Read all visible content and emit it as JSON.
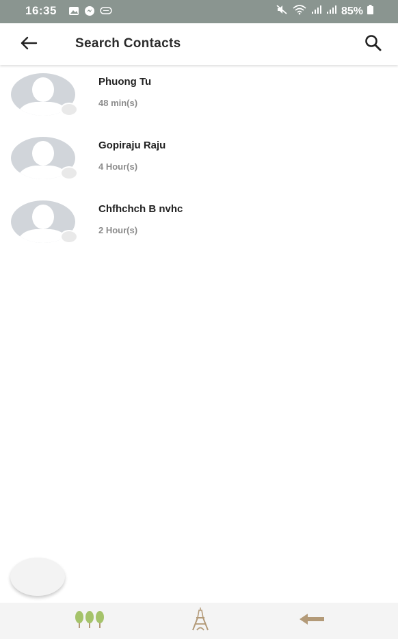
{
  "status_bar": {
    "time": "16:35",
    "battery_percent": "85%",
    "icons_left": [
      "image-icon",
      "messenger-icon",
      "chat-bubble-icon"
    ],
    "icons_right": [
      "mute-icon",
      "wifi-icon",
      "signal-icon",
      "signal-icon",
      "battery-icon"
    ]
  },
  "toolbar": {
    "title": "Search Contacts",
    "back_icon": "arrow-left-icon",
    "search_icon": "search-icon"
  },
  "contacts": [
    {
      "name": "Phuong Tu",
      "last_seen": "48 min(s)"
    },
    {
      "name": "Gopiraju Raju",
      "last_seen": "4 Hour(s)"
    },
    {
      "name": "Chfhchch B nvhc",
      "last_seen": "2 Hour(s)"
    }
  ],
  "bottom_nav": {
    "items": [
      "trees-icon",
      "eiffel-tower-icon",
      "arrow-left-icon"
    ]
  },
  "colors": {
    "status_bar": "#8a9590",
    "avatar": "#d1d5da",
    "nav_icon": "#b39a78",
    "tree_green": "#a5c36a"
  }
}
